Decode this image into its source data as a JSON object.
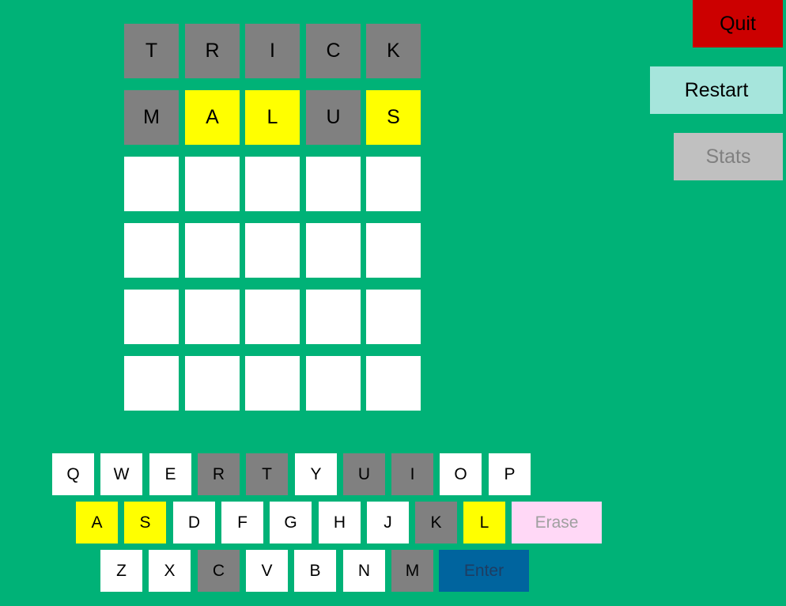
{
  "colors": {
    "background": "#00b277",
    "absent": "#808080",
    "present": "#ffff00",
    "empty": "#ffffff",
    "unused_key": "#ffffff"
  },
  "board": {
    "rows": [
      [
        {
          "letter": "T",
          "state": "absent"
        },
        {
          "letter": "R",
          "state": "absent"
        },
        {
          "letter": "I",
          "state": "absent"
        },
        {
          "letter": "C",
          "state": "absent"
        },
        {
          "letter": "K",
          "state": "absent"
        }
      ],
      [
        {
          "letter": "M",
          "state": "absent"
        },
        {
          "letter": "A",
          "state": "present"
        },
        {
          "letter": "L",
          "state": "present"
        },
        {
          "letter": "U",
          "state": "absent"
        },
        {
          "letter": "S",
          "state": "present"
        }
      ],
      [
        {
          "letter": "",
          "state": "empty"
        },
        {
          "letter": "",
          "state": "empty"
        },
        {
          "letter": "",
          "state": "empty"
        },
        {
          "letter": "",
          "state": "empty"
        },
        {
          "letter": "",
          "state": "empty"
        }
      ],
      [
        {
          "letter": "",
          "state": "empty"
        },
        {
          "letter": "",
          "state": "empty"
        },
        {
          "letter": "",
          "state": "empty"
        },
        {
          "letter": "",
          "state": "empty"
        },
        {
          "letter": "",
          "state": "empty"
        }
      ],
      [
        {
          "letter": "",
          "state": "empty"
        },
        {
          "letter": "",
          "state": "empty"
        },
        {
          "letter": "",
          "state": "empty"
        },
        {
          "letter": "",
          "state": "empty"
        },
        {
          "letter": "",
          "state": "empty"
        }
      ],
      [
        {
          "letter": "",
          "state": "empty"
        },
        {
          "letter": "",
          "state": "empty"
        },
        {
          "letter": "",
          "state": "empty"
        },
        {
          "letter": "",
          "state": "empty"
        },
        {
          "letter": "",
          "state": "empty"
        }
      ]
    ]
  },
  "keyboard": {
    "rows": [
      [
        {
          "label": "Q",
          "state": "unused"
        },
        {
          "label": "W",
          "state": "unused"
        },
        {
          "label": "E",
          "state": "unused"
        },
        {
          "label": "R",
          "state": "absent"
        },
        {
          "label": "T",
          "state": "absent"
        },
        {
          "label": "Y",
          "state": "unused"
        },
        {
          "label": "U",
          "state": "absent"
        },
        {
          "label": "I",
          "state": "absent"
        },
        {
          "label": "O",
          "state": "unused"
        },
        {
          "label": "P",
          "state": "unused"
        }
      ],
      [
        {
          "label": "A",
          "state": "present"
        },
        {
          "label": "S",
          "state": "present"
        },
        {
          "label": "D",
          "state": "unused"
        },
        {
          "label": "F",
          "state": "unused"
        },
        {
          "label": "G",
          "state": "unused"
        },
        {
          "label": "H",
          "state": "unused"
        },
        {
          "label": "J",
          "state": "unused"
        },
        {
          "label": "K",
          "state": "absent"
        },
        {
          "label": "L",
          "state": "present"
        }
      ],
      [
        {
          "label": "Z",
          "state": "unused"
        },
        {
          "label": "X",
          "state": "unused"
        },
        {
          "label": "C",
          "state": "absent"
        },
        {
          "label": "V",
          "state": "unused"
        },
        {
          "label": "B",
          "state": "unused"
        },
        {
          "label": "N",
          "state": "unused"
        },
        {
          "label": "M",
          "state": "absent"
        }
      ]
    ],
    "erase": {
      "label": "Erase",
      "bg": "#ffd8f6",
      "color": "#a0a0a0"
    },
    "enter": {
      "label": "Enter",
      "bg": "#00649e",
      "color": "#1e3d62"
    }
  },
  "buttons": {
    "quit": {
      "label": "Quit",
      "bg": "#cc0000",
      "color": "#000000"
    },
    "restart": {
      "label": "Restart",
      "bg": "#a6e5dc",
      "color": "#000000"
    },
    "stats": {
      "label": "Stats",
      "bg": "#c0c0c0",
      "color": "#808080"
    }
  }
}
